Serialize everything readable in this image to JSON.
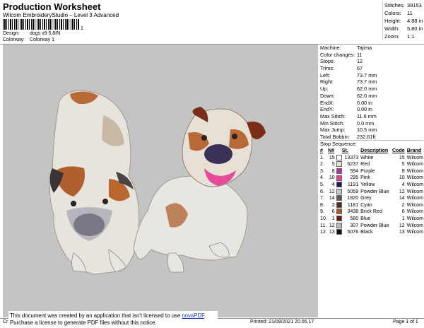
{
  "header": {
    "title": "Production Worksheet",
    "subtitle": "Wilcom EmbroideryStudio – Level 3 Advanced",
    "barcode_mark": "1",
    "design_label": "Design:",
    "design_value": "dogs v9 5,8IN",
    "colorway_label": "Colorway:",
    "colorway_value": "Colorway 1"
  },
  "stats": [
    {
      "k": "Stitches:",
      "v": "39153"
    },
    {
      "k": "Colors:",
      "v": "11"
    },
    {
      "k": "Height:",
      "v": "4.88 in"
    },
    {
      "k": "Width:",
      "v": "5.80 in"
    },
    {
      "k": "Zoom:",
      "v": "1:1"
    }
  ],
  "machine": [
    {
      "k": "Machine:",
      "v": "Tajima"
    },
    {
      "k": "Color changes:",
      "v": "11"
    },
    {
      "k": "Stops:",
      "v": "12"
    },
    {
      "k": "Trims:",
      "v": "67"
    },
    {
      "k": "Left:",
      "v": "73.7 mm"
    },
    {
      "k": "Right:",
      "v": "73.7 mm"
    },
    {
      "k": "Up:",
      "v": "62.0 mm"
    },
    {
      "k": "Down:",
      "v": "62.0 mm"
    },
    {
      "k": "EndX:",
      "v": "0.00 in"
    },
    {
      "k": "EndY:",
      "v": "0.00 in"
    },
    {
      "k": "Max Stitch:",
      "v": "11.6 mm"
    },
    {
      "k": "Min Stitch:",
      "v": "0.0 mm"
    },
    {
      "k": "Max Jump:",
      "v": "10.5 mm"
    },
    {
      "k": "Total Bobbin:",
      "v": "232.61ft"
    }
  ],
  "stop_sequence": {
    "heading": "Stop Sequence:",
    "columns": [
      "#",
      "N#",
      "St.",
      "Description",
      "Code",
      "Brand"
    ],
    "rows": [
      {
        "n": "1.",
        "nn": "15",
        "color": "#ffffff",
        "st": "13373",
        "desc": "White",
        "code": "15",
        "brand": "Wilcom"
      },
      {
        "n": "2.",
        "nn": "5",
        "color": "#f5dcd0",
        "st": "6237",
        "desc": "Red",
        "code": "5",
        "brand": "Wilcom"
      },
      {
        "n": "3.",
        "nn": "8",
        "color": "#c02a9a",
        "st": "594",
        "desc": "Purple",
        "code": "8",
        "brand": "Wilcom"
      },
      {
        "n": "4.",
        "nn": "10",
        "color": "#f03c9c",
        "st": "295",
        "desc": "Pink",
        "code": "10",
        "brand": "Wilcom"
      },
      {
        "n": "5.",
        "nn": "4",
        "color": "#1a1a5a",
        "st": "1191",
        "desc": "Yellow",
        "code": "4",
        "brand": "Wilcom"
      },
      {
        "n": "6.",
        "nn": "12",
        "color": "#c8c8cc",
        "st": "5059",
        "desc": "Powder Blue",
        "code": "12",
        "brand": "Wilcom"
      },
      {
        "n": "7.",
        "nn": "14",
        "color": "#5a5a5e",
        "st": "1820",
        "desc": "Grey",
        "code": "14",
        "brand": "Wilcom"
      },
      {
        "n": "8.",
        "nn": "2",
        "color": "#5a2a12",
        "st": "1181",
        "desc": "Cyan",
        "code": "2",
        "brand": "Wilcom"
      },
      {
        "n": "9.",
        "nn": "6",
        "color": "#b25a28",
        "st": "3438",
        "desc": "Brick Red",
        "code": "6",
        "brand": "Wilcom"
      },
      {
        "n": "10.",
        "nn": "1",
        "color": "#6a1a0a",
        "st": "580",
        "desc": "Blue",
        "code": "1",
        "brand": "Wilcom"
      },
      {
        "n": "11.",
        "nn": "12",
        "color": "#b8b8c8",
        "st": "307",
        "desc": "Powder Blue",
        "code": "12",
        "brand": "Wilcom"
      },
      {
        "n": "12.",
        "nn": "13",
        "color": "#111111",
        "st": "5076",
        "desc": "Black",
        "code": "13",
        "brand": "Wilcom"
      }
    ]
  },
  "notice": {
    "line1": "This document was created by an application that isn't licensed to use ",
    "link": "novaPDF",
    "line1_end": ".",
    "line2": "Purchase a license to generate PDF files without this notice."
  },
  "footer": {
    "left": "Cr",
    "printed": "Printed: 21/08/2021 20.05.17",
    "page": "Page 1 of 1"
  }
}
